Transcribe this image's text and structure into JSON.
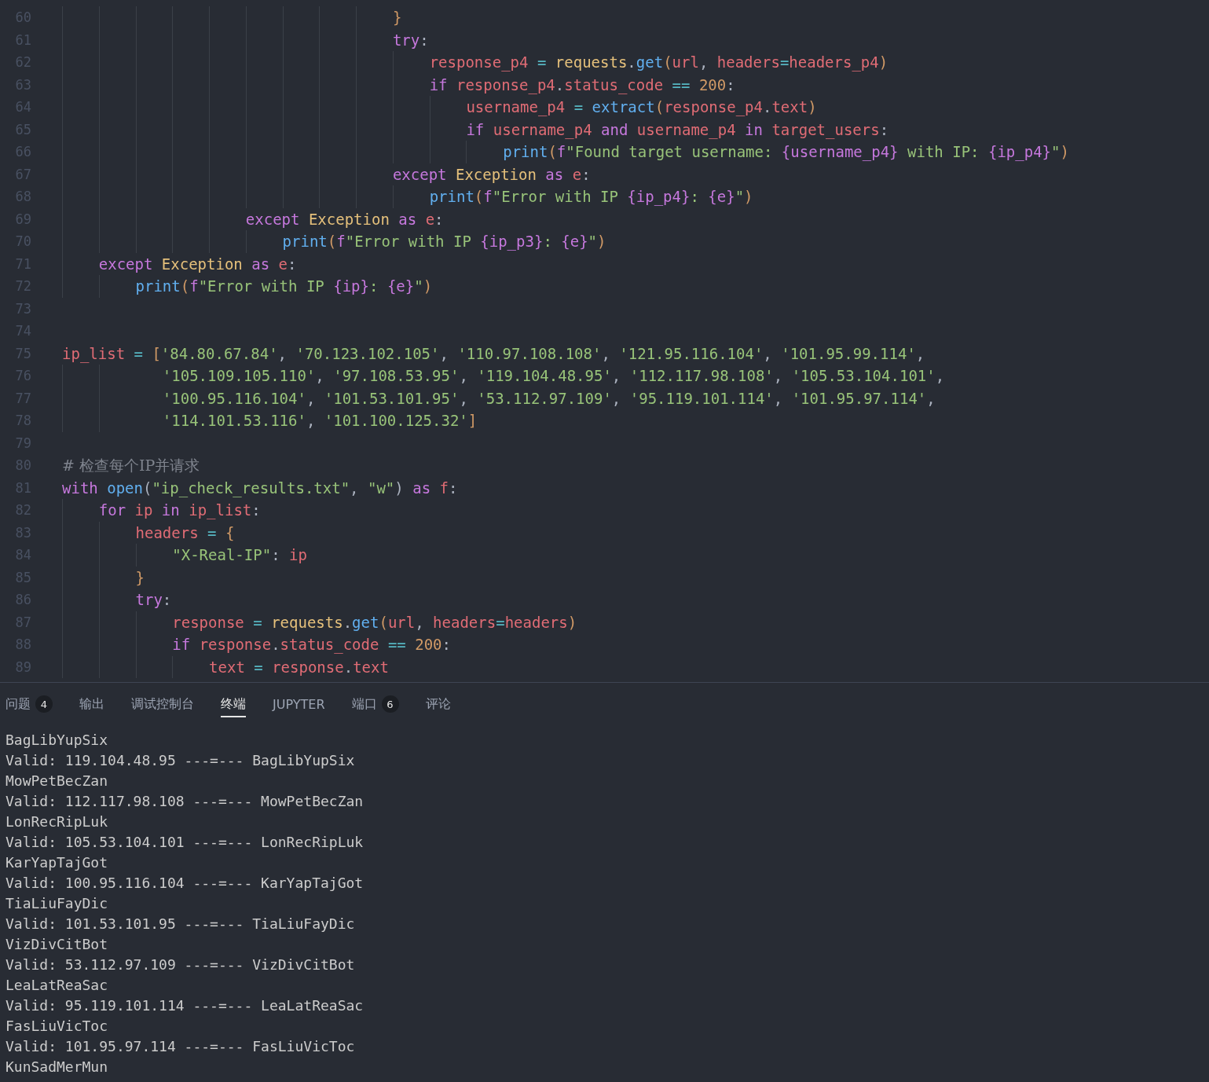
{
  "editor": {
    "lines": [
      {
        "number": "60",
        "tokens": [
          {
            "kind": "bracket",
            "text": "                                    }"
          }
        ]
      },
      {
        "number": "61",
        "tokens": [
          {
            "kind": "kw",
            "text": "                                    try"
          },
          {
            "kind": "punct",
            "text": ":"
          }
        ]
      },
      {
        "number": "62",
        "tokens": [
          {
            "kind": "var",
            "text": "                                        response_p4"
          },
          {
            "kind": "op",
            "text": " = "
          },
          {
            "kind": "cls",
            "text": "requests"
          },
          {
            "kind": "punct",
            "text": "."
          },
          {
            "kind": "fn",
            "text": "get"
          },
          {
            "kind": "bracket",
            "text": "("
          },
          {
            "kind": "var",
            "text": "url"
          },
          {
            "kind": "punct",
            "text": ", "
          },
          {
            "kind": "var",
            "text": "headers"
          },
          {
            "kind": "op",
            "text": "="
          },
          {
            "kind": "var",
            "text": "headers_p4"
          },
          {
            "kind": "bracket",
            "text": ")"
          }
        ]
      },
      {
        "number": "63",
        "tokens": [
          {
            "kind": "kw",
            "text": "                                        if "
          },
          {
            "kind": "var",
            "text": "response_p4"
          },
          {
            "kind": "punct",
            "text": "."
          },
          {
            "kind": "var",
            "text": "status_code"
          },
          {
            "kind": "op",
            "text": " == "
          },
          {
            "kind": "num",
            "text": "200"
          },
          {
            "kind": "punct",
            "text": ":"
          }
        ]
      },
      {
        "number": "64",
        "tokens": [
          {
            "kind": "var",
            "text": "                                            username_p4"
          },
          {
            "kind": "op",
            "text": " = "
          },
          {
            "kind": "fn",
            "text": "extract"
          },
          {
            "kind": "bracket",
            "text": "("
          },
          {
            "kind": "var",
            "text": "response_p4"
          },
          {
            "kind": "punct",
            "text": "."
          },
          {
            "kind": "var",
            "text": "text"
          },
          {
            "kind": "bracket",
            "text": ")"
          }
        ]
      },
      {
        "number": "65",
        "tokens": [
          {
            "kind": "kw",
            "text": "                                            if "
          },
          {
            "kind": "var",
            "text": "username_p4"
          },
          {
            "kind": "kw",
            "text": " and "
          },
          {
            "kind": "var",
            "text": "username_p4"
          },
          {
            "kind": "kw",
            "text": " in "
          },
          {
            "kind": "var",
            "text": "target_users"
          },
          {
            "kind": "punct",
            "text": ":"
          }
        ]
      },
      {
        "number": "66",
        "tokens": [
          {
            "kind": "fn",
            "text": "                                                print"
          },
          {
            "kind": "bracket",
            "text": "("
          },
          {
            "kind": "kw",
            "text": "f"
          },
          {
            "kind": "str",
            "text": "\"Found target username: "
          },
          {
            "kind": "interp",
            "text": "{username_p4}"
          },
          {
            "kind": "str",
            "text": " with IP: "
          },
          {
            "kind": "interp",
            "text": "{ip_p4}"
          },
          {
            "kind": "str",
            "text": "\""
          },
          {
            "kind": "bracket",
            "text": ")"
          }
        ]
      },
      {
        "number": "67",
        "tokens": [
          {
            "kind": "kw",
            "text": "                                    except "
          },
          {
            "kind": "cls",
            "text": "Exception"
          },
          {
            "kind": "kw",
            "text": " as "
          },
          {
            "kind": "var",
            "text": "e"
          },
          {
            "kind": "punct",
            "text": ":"
          }
        ]
      },
      {
        "number": "68",
        "tokens": [
          {
            "kind": "fn",
            "text": "                                        print"
          },
          {
            "kind": "bracket",
            "text": "("
          },
          {
            "kind": "kw",
            "text": "f"
          },
          {
            "kind": "str",
            "text": "\"Error with IP "
          },
          {
            "kind": "interp",
            "text": "{ip_p4}"
          },
          {
            "kind": "str",
            "text": ": "
          },
          {
            "kind": "interp",
            "text": "{e}"
          },
          {
            "kind": "str",
            "text": "\""
          },
          {
            "kind": "bracket",
            "text": ")"
          }
        ]
      },
      {
        "number": "69",
        "tokens": [
          {
            "kind": "kw",
            "text": "                    except "
          },
          {
            "kind": "cls",
            "text": "Exception"
          },
          {
            "kind": "kw",
            "text": " as "
          },
          {
            "kind": "var",
            "text": "e"
          },
          {
            "kind": "punct",
            "text": ":"
          }
        ]
      },
      {
        "number": "70",
        "tokens": [
          {
            "kind": "fn",
            "text": "                        print"
          },
          {
            "kind": "bracket",
            "text": "("
          },
          {
            "kind": "kw",
            "text": "f"
          },
          {
            "kind": "str",
            "text": "\"Error with IP "
          },
          {
            "kind": "interp",
            "text": "{ip_p3}"
          },
          {
            "kind": "str",
            "text": ": "
          },
          {
            "kind": "interp",
            "text": "{e}"
          },
          {
            "kind": "str",
            "text": "\""
          },
          {
            "kind": "bracket",
            "text": ")"
          }
        ]
      },
      {
        "number": "71",
        "tokens": [
          {
            "kind": "kw",
            "text": "    except "
          },
          {
            "kind": "cls",
            "text": "Exception"
          },
          {
            "kind": "kw",
            "text": " as "
          },
          {
            "kind": "var",
            "text": "e"
          },
          {
            "kind": "punct",
            "text": ":"
          }
        ]
      },
      {
        "number": "72",
        "tokens": [
          {
            "kind": "fn",
            "text": "        print"
          },
          {
            "kind": "bracket",
            "text": "("
          },
          {
            "kind": "kw",
            "text": "f"
          },
          {
            "kind": "str",
            "text": "\"Error with IP "
          },
          {
            "kind": "interp",
            "text": "{ip}"
          },
          {
            "kind": "str",
            "text": ": "
          },
          {
            "kind": "interp",
            "text": "{e}"
          },
          {
            "kind": "str",
            "text": "\""
          },
          {
            "kind": "bracket",
            "text": ")"
          }
        ]
      },
      {
        "number": "73"
      },
      {
        "number": "74"
      },
      {
        "number": "75",
        "tokens": [
          {
            "kind": "var",
            "text": "ip_list"
          },
          {
            "kind": "op",
            "text": " = "
          },
          {
            "kind": "bracket",
            "text": "["
          },
          {
            "kind": "str",
            "text": "'84.80.67.84'"
          },
          {
            "kind": "punct",
            "text": ", "
          },
          {
            "kind": "str",
            "text": "'70.123.102.105'"
          },
          {
            "kind": "punct",
            "text": ", "
          },
          {
            "kind": "str",
            "text": "'110.97.108.108'"
          },
          {
            "kind": "punct",
            "text": ", "
          },
          {
            "kind": "str",
            "text": "'121.95.116.104'"
          },
          {
            "kind": "punct",
            "text": ", "
          },
          {
            "kind": "str",
            "text": "'101.95.99.114'"
          },
          {
            "kind": "punct",
            "text": ","
          }
        ]
      },
      {
        "number": "76",
        "tokens": [
          {
            "kind": "str",
            "text": "           '105.109.105.110'"
          },
          {
            "kind": "punct",
            "text": ", "
          },
          {
            "kind": "str",
            "text": "'97.108.53.95'"
          },
          {
            "kind": "punct",
            "text": ", "
          },
          {
            "kind": "str",
            "text": "'119.104.48.95'"
          },
          {
            "kind": "punct",
            "text": ", "
          },
          {
            "kind": "str",
            "text": "'112.117.98.108'"
          },
          {
            "kind": "punct",
            "text": ", "
          },
          {
            "kind": "str",
            "text": "'105.53.104.101'"
          },
          {
            "kind": "punct",
            "text": ","
          }
        ]
      },
      {
        "number": "77",
        "tokens": [
          {
            "kind": "str",
            "text": "           '100.95.116.104'"
          },
          {
            "kind": "punct",
            "text": ", "
          },
          {
            "kind": "str",
            "text": "'101.53.101.95'"
          },
          {
            "kind": "punct",
            "text": ", "
          },
          {
            "kind": "str",
            "text": "'53.112.97.109'"
          },
          {
            "kind": "punct",
            "text": ", "
          },
          {
            "kind": "str",
            "text": "'95.119.101.114'"
          },
          {
            "kind": "punct",
            "text": ", "
          },
          {
            "kind": "str",
            "text": "'101.95.97.114'"
          },
          {
            "kind": "punct",
            "text": ","
          }
        ]
      },
      {
        "number": "78",
        "tokens": [
          {
            "kind": "str",
            "text": "           '114.101.53.116'"
          },
          {
            "kind": "punct",
            "text": ", "
          },
          {
            "kind": "str",
            "text": "'101.100.125.32'"
          },
          {
            "kind": "bracket",
            "text": "]"
          }
        ]
      },
      {
        "number": "79"
      },
      {
        "number": "80",
        "tokens": [
          {
            "kind": "cmt",
            "text": "# 检查每个IP并请求"
          }
        ]
      },
      {
        "number": "81",
        "tokens": [
          {
            "kind": "kw",
            "text": "with "
          },
          {
            "kind": "fn",
            "text": "open"
          },
          {
            "kind": "punct",
            "text": "("
          },
          {
            "kind": "str",
            "text": "\"ip_check_results.txt\""
          },
          {
            "kind": "punct",
            "text": ", "
          },
          {
            "kind": "str",
            "text": "\"w\""
          },
          {
            "kind": "punct",
            "text": ")"
          },
          {
            "kind": "kw",
            "text": " as "
          },
          {
            "kind": "var",
            "text": "f"
          },
          {
            "kind": "punct",
            "text": ":"
          }
        ]
      },
      {
        "number": "82",
        "tokens": [
          {
            "kind": "kw",
            "text": "    for "
          },
          {
            "kind": "var",
            "text": "ip"
          },
          {
            "kind": "kw",
            "text": " in "
          },
          {
            "kind": "var",
            "text": "ip_list"
          },
          {
            "kind": "punct",
            "text": ":"
          }
        ]
      },
      {
        "number": "83",
        "tokens": [
          {
            "kind": "var",
            "text": "        headers"
          },
          {
            "kind": "op",
            "text": " = "
          },
          {
            "kind": "bracket",
            "text": "{"
          }
        ]
      },
      {
        "number": "84",
        "tokens": [
          {
            "kind": "str",
            "text": "            \"X-Real-IP\""
          },
          {
            "kind": "punct",
            "text": ": "
          },
          {
            "kind": "var",
            "text": "ip"
          }
        ]
      },
      {
        "number": "85",
        "tokens": [
          {
            "kind": "bracket",
            "text": "        }"
          }
        ]
      },
      {
        "number": "86",
        "tokens": [
          {
            "kind": "kw",
            "text": "        try"
          },
          {
            "kind": "punct",
            "text": ":"
          }
        ]
      },
      {
        "number": "87",
        "tokens": [
          {
            "kind": "var",
            "text": "            response"
          },
          {
            "kind": "op",
            "text": " = "
          },
          {
            "kind": "cls",
            "text": "requests"
          },
          {
            "kind": "punct",
            "text": "."
          },
          {
            "kind": "fn",
            "text": "get"
          },
          {
            "kind": "bracket",
            "text": "("
          },
          {
            "kind": "var",
            "text": "url"
          },
          {
            "kind": "punct",
            "text": ", "
          },
          {
            "kind": "var",
            "text": "headers"
          },
          {
            "kind": "op",
            "text": "="
          },
          {
            "kind": "var",
            "text": "headers"
          },
          {
            "kind": "bracket",
            "text": ")"
          }
        ]
      },
      {
        "number": "88",
        "tokens": [
          {
            "kind": "kw",
            "text": "            if "
          },
          {
            "kind": "var",
            "text": "response"
          },
          {
            "kind": "punct",
            "text": "."
          },
          {
            "kind": "var",
            "text": "status_code"
          },
          {
            "kind": "op",
            "text": " == "
          },
          {
            "kind": "num",
            "text": "200"
          },
          {
            "kind": "punct",
            "text": ":"
          }
        ]
      },
      {
        "number": "89",
        "tokens": [
          {
            "kind": "var",
            "text": "                text"
          },
          {
            "kind": "op",
            "text": " = "
          },
          {
            "kind": "var",
            "text": "response"
          },
          {
            "kind": "punct",
            "text": "."
          },
          {
            "kind": "var",
            "text": "text"
          }
        ]
      }
    ]
  },
  "panel": {
    "tabs": [
      {
        "label": "问题",
        "badge": "4",
        "selected": false
      },
      {
        "label": "输出",
        "selected": false
      },
      {
        "label": "调试控制台",
        "selected": false
      },
      {
        "label": "终端",
        "selected": true
      },
      {
        "label": "JUPYTER",
        "selected": false
      },
      {
        "label": "端口",
        "badge": "6",
        "selected": false
      },
      {
        "label": "评论",
        "selected": false
      }
    ],
    "terminal_lines": [
      "BagLibYupSix",
      "Valid: 119.104.48.95 ---=--- BagLibYupSix",
      "MowPetBecZan",
      "Valid: 112.117.98.108 ---=--- MowPetBecZan",
      "LonRecRipLuk",
      "Valid: 105.53.104.101 ---=--- LonRecRipLuk",
      "KarYapTajGot",
      "Valid: 100.95.116.104 ---=--- KarYapTajGot",
      "TiaLiuFayDic",
      "Valid: 101.53.101.95 ---=--- TiaLiuFayDic",
      "VizDivCitBot",
      "Valid: 53.112.97.109 ---=--- VizDivCitBot",
      "LeaLatReaSac",
      "Valid: 95.119.101.114 ---=--- LeaLatReaSac",
      "FasLiuVicToc",
      "Valid: 101.95.97.114 ---=--- FasLiuVicToc",
      "KunSadMerMun"
    ]
  }
}
